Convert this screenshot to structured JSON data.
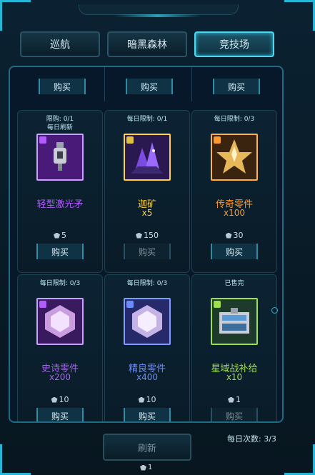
{
  "tabs": [
    {
      "label": "巡航",
      "active": false
    },
    {
      "label": "暗黑森林",
      "active": false
    },
    {
      "label": "竞技场",
      "active": true
    }
  ],
  "partial_row": {
    "buttons": [
      "购买",
      "购买",
      "购买"
    ]
  },
  "items": [
    {
      "limit_line1": "限购: 0/1",
      "limit_line2": "每日刷新",
      "name": "轻型激光矛",
      "qty": "",
      "price": "5",
      "buy": "购买",
      "buy_enabled": true,
      "name_color": "#b15cff",
      "frame_color": "#c9a0ff",
      "icon": "laser-spear-icon",
      "badge_color": "#b15cff"
    },
    {
      "limit_line1": "每日限制: 0/1",
      "limit_line2": "",
      "name": "迦矿",
      "qty": "x5",
      "price": "150",
      "buy": "购买",
      "buy_enabled": false,
      "name_color": "#ffd23f",
      "frame_color": "#ffd23f",
      "icon": "crystal-ore-icon",
      "badge_color": "#e0c040"
    },
    {
      "limit_line1": "每日限制: 0/3",
      "limit_line2": "",
      "name": "传奇零件",
      "qty": "x100",
      "price": "30",
      "buy": "购买",
      "buy_enabled": true,
      "name_color": "#ff9a2e",
      "frame_color": "#ffb24a",
      "icon": "legendary-part-icon",
      "badge_color": "#ff9a2e"
    },
    {
      "limit_line1": "每日限制: 0/3",
      "limit_line2": "",
      "name": "史诗零件",
      "qty": "x200",
      "price": "10",
      "buy": "购买",
      "buy_enabled": true,
      "name_color": "#b15cff",
      "frame_color": "#c9a0ff",
      "icon": "epic-part-icon",
      "badge_color": "#b15cff"
    },
    {
      "limit_line1": "每日限制: 0/3",
      "limit_line2": "",
      "name": "精良零件",
      "qty": "x400",
      "price": "10",
      "buy": "购买",
      "buy_enabled": true,
      "name_color": "#6b8cff",
      "frame_color": "#7f9cff",
      "icon": "fine-part-icon",
      "badge_color": "#6b8cff"
    },
    {
      "limit_line1": "已售完",
      "limit_line2": "",
      "name": "星域战补给",
      "qty": "x10",
      "price": "1",
      "buy": "购买",
      "buy_enabled": false,
      "name_color": "#9ee04a",
      "frame_color": "#9ee04a",
      "icon": "supply-crate-icon",
      "badge_color": "#9ee04a"
    }
  ],
  "footer": {
    "daily_count": "每日次数: 3/3",
    "refresh_label": "刷新",
    "refresh_cost": "1"
  }
}
